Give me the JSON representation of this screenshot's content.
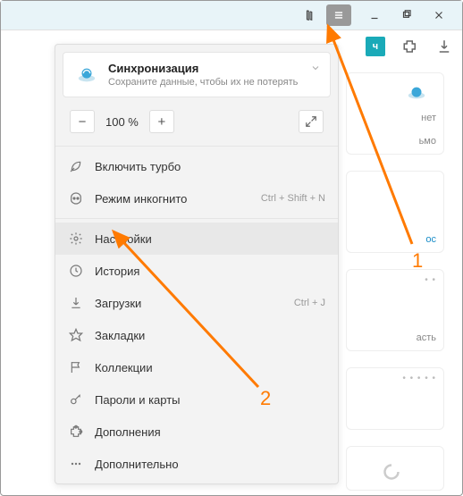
{
  "titlebar": {
    "library_tooltip": "Library",
    "menu_tooltip": "Menu"
  },
  "toolbar": {
    "tile_label": "ч"
  },
  "sync": {
    "title": "Синхронизация",
    "subtitle": "Сохраните данные, чтобы их не потерять"
  },
  "zoom": {
    "minus": "−",
    "value": "100 %",
    "plus": "+"
  },
  "menu": {
    "turbo": "Включить турбо",
    "incognito": "Режим инкогнито",
    "incognito_shortcut": "Ctrl + Shift + N",
    "settings": "Настройки",
    "history": "История",
    "downloads": "Загрузки",
    "downloads_shortcut": "Ctrl + J",
    "bookmarks": "Закладки",
    "collections": "Коллекции",
    "passwords": "Пароли и карты",
    "addons": "Дополнения",
    "more": "Дополнительно"
  },
  "bg": {
    "t1": "нет",
    "t2": "ьмо",
    "t3": "ос",
    "t4": "асть"
  },
  "annotations": {
    "n1": "1",
    "n2": "2"
  }
}
